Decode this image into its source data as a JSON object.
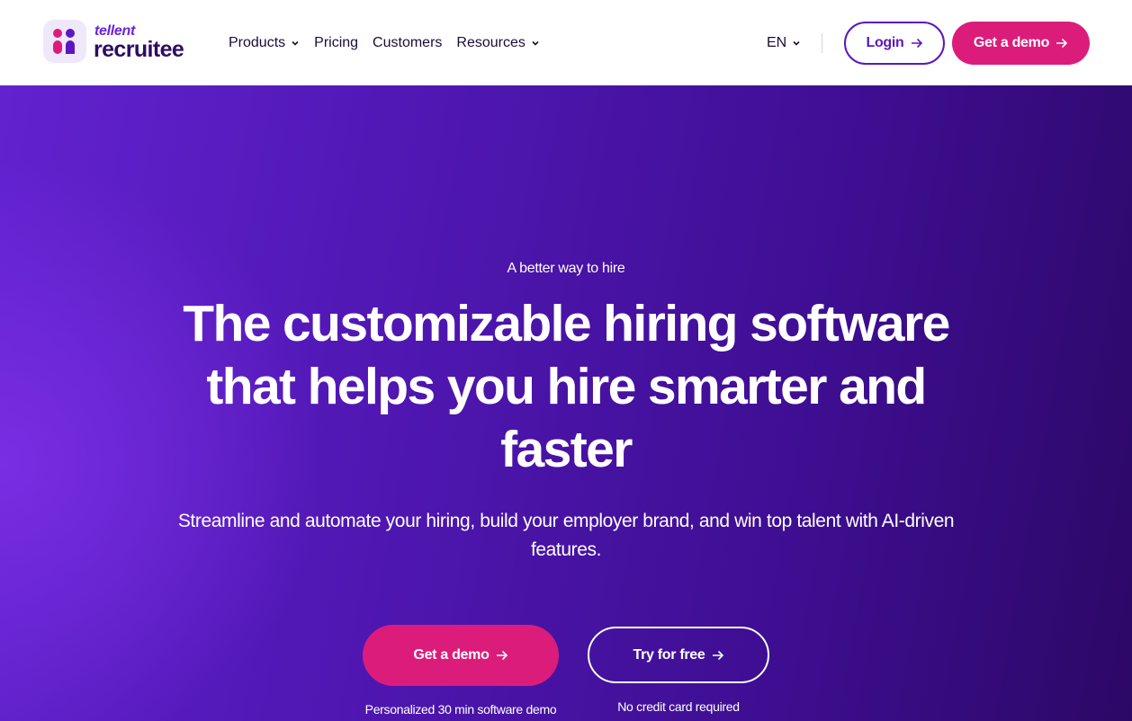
{
  "header": {
    "logo": {
      "brand_small": "tellent",
      "brand_big": "recruitee"
    },
    "nav": [
      {
        "label": "Products",
        "has_dropdown": true
      },
      {
        "label": "Pricing",
        "has_dropdown": false
      },
      {
        "label": "Customers",
        "has_dropdown": false
      },
      {
        "label": "Resources",
        "has_dropdown": true
      }
    ],
    "language": "EN",
    "login_label": "Login",
    "demo_label": "Get a demo"
  },
  "hero": {
    "eyebrow": "A better way to hire",
    "headline": "The customizable hiring software that helps you hire smarter and faster",
    "subheadline": "Streamline and automate your hiring, build your employer brand, and win top talent with AI-driven features.",
    "primary_cta": "Get a demo",
    "primary_note": "Personalized 30 min software demo",
    "secondary_cta": "Try for free",
    "secondary_note": "No credit card required"
  },
  "colors": {
    "brand_purple": "#5b17c2",
    "brand_pink": "#dc1c7b",
    "logo_dark": "#2e0c62",
    "hero_gradient_start": "#6222cf",
    "hero_gradient_end": "#2c0866"
  },
  "icons": [
    "logo-icon",
    "chevron-down-icon",
    "arrow-right-icon"
  ]
}
